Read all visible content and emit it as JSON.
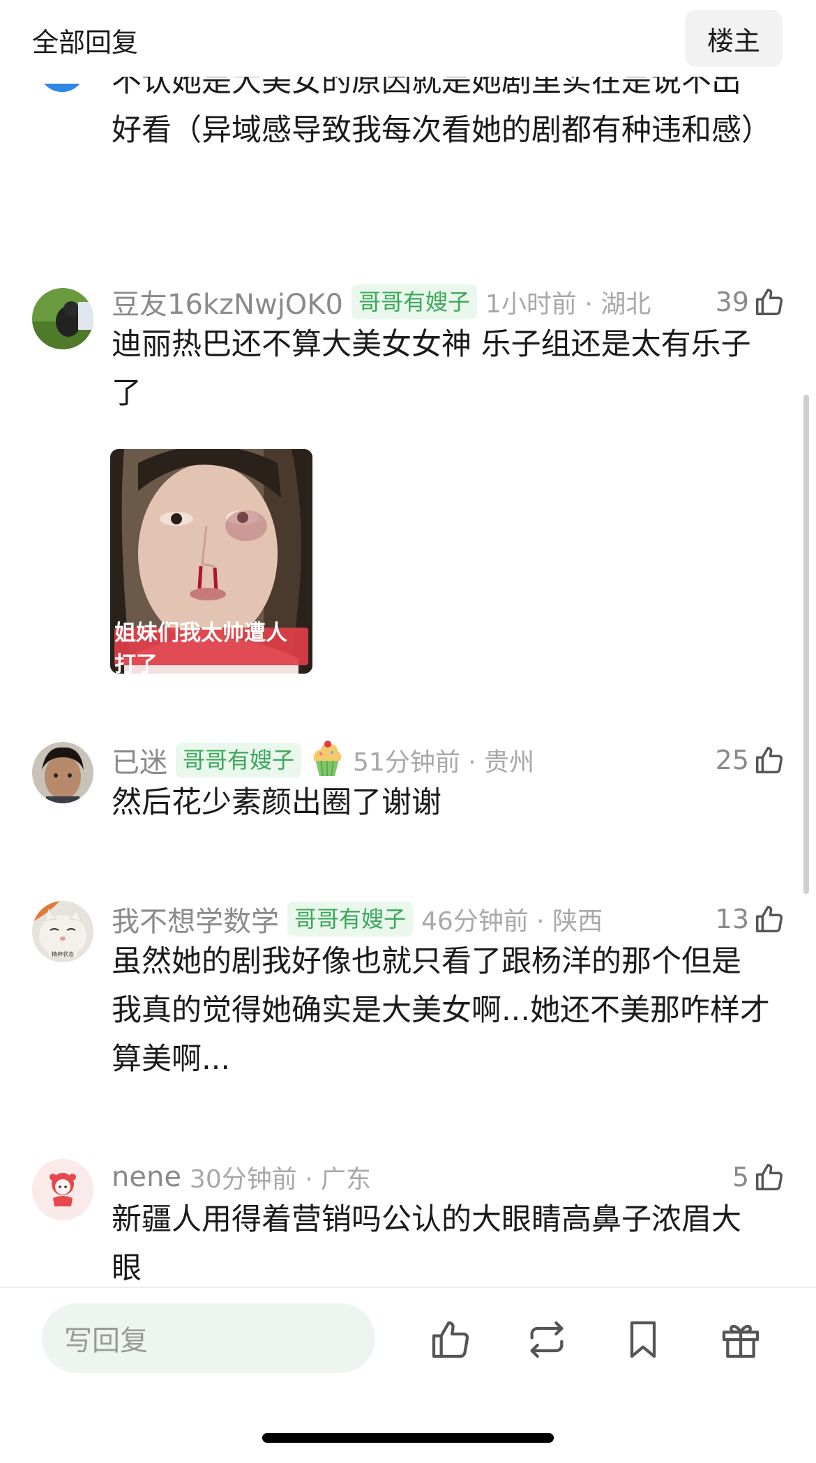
{
  "header": {
    "title": "全部回复",
    "op_label": "楼主"
  },
  "top_comment": {
    "text": "不认她是大美女的原因就是她剧里实在是说不出好看（异域感导致我每次看她的剧都有种违和感）"
  },
  "comments": [
    {
      "username": "豆友16kzNwjOK0",
      "badge": "哥哥有嫂子",
      "time_location": "1小时前 · 湖北",
      "likes": "39",
      "text": "迪丽热巴还不算大美女女神 乐子组还是太有乐子了",
      "image_caption": "姐妹们我太帅遭人打了"
    },
    {
      "username": "已迷",
      "badge": "哥哥有嫂子",
      "time_location": "51分钟前 · 贵州",
      "likes": "25",
      "text": "然后花少素颜出圈了谢谢"
    },
    {
      "username": "我不想学数学",
      "badge": "哥哥有嫂子",
      "time_location": "46分钟前 · 陕西",
      "likes": "13",
      "text": "虽然她的剧我好像也就只看了跟杨洋的那个但是我真的觉得她确实是大美女啊...她还不美那咋样才算美啊..."
    },
    {
      "username": "nene",
      "time_location": "30分钟前 · 广东",
      "likes": "5",
      "text": "新疆人用得着营销吗公认的大眼睛高鼻子浓眉大眼"
    }
  ],
  "bottom_bar": {
    "reply_placeholder": "写回复",
    "icons": [
      "like-icon",
      "repost-icon",
      "bookmark-icon",
      "gift-icon"
    ]
  },
  "colors": {
    "badge_green": "#3aa858",
    "badge_bg": "#e9f7ec",
    "input_bg": "#eef4f0"
  }
}
